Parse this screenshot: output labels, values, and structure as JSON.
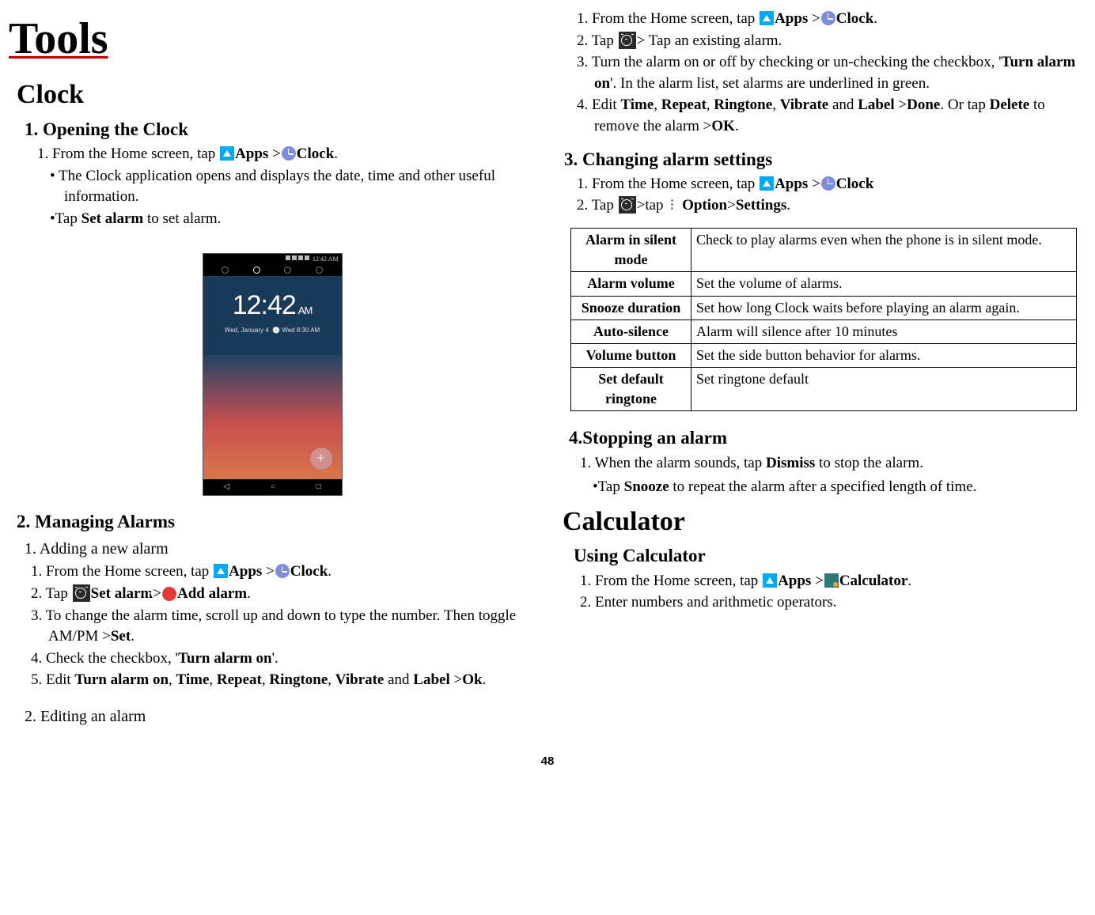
{
  "pageNumber": "48",
  "title": "Tools",
  "left": {
    "clockHeading": "Clock",
    "s1": {
      "heading": "1. Opening the Clock",
      "step1_pre": "1. From the Home screen, tap  ",
      "apps": "Apps",
      "gt": " >",
      "clock": "Clock",
      "period": ".",
      "b1": "• The Clock application opens and displays the date, time and other useful information.",
      "b2_pre": "•Tap ",
      "b2_bold": "Set alarm",
      "b2_post": " to set alarm."
    },
    "phone": {
      "statusTime": "12:42 AM",
      "time": "12:42",
      "ampm": "AM",
      "date": "Wed, January 4",
      "alarm": "Wed 8:30 AM",
      "plus": "+",
      "navBack": "◁",
      "navHome": "○",
      "navRecent": "□"
    },
    "s2": {
      "heading": "2. Managing Alarms",
      "sub1": "1. Adding a new alarm",
      "a1_pre": "1. From the Home screen, tap  ",
      "a1_apps": "Apps",
      "a1_gt": " >",
      "a1_clock": "Clock",
      "a1_period": ".",
      "a2_pre": "2. Tap  ",
      "a2_set": "Set alarm",
      "a2_gt": ">",
      "a2_add": "Add alarm",
      "a2_period": ".",
      "a3_pre": "3. To change the alarm time, scroll up and down to type the number. Then toggle AM/PM >",
      "a3_set": "Set",
      "a3_period": ".",
      "a4_pre": "4. Check the checkbox, '",
      "a4_bold": "Turn alarm on",
      "a4_post": "'.",
      "a5_pre": "5. Edit ",
      "a5_1": "Turn alarm on",
      "a5_c": ", ",
      "a5_2": "Time",
      "a5_3": "Repeat",
      "a5_4": "Ringtone",
      "a5_5": "Vibrate",
      "a5_and": " and ",
      "a5_6": "Label",
      "a5_gt": " >",
      "a5_7": "Ok",
      "a5_period": ".",
      "sub2": "2. Editing an alarm"
    }
  },
  "right": {
    "e1_pre": "1. From the Home screen, tap  ",
    "e1_apps": "Apps",
    "e1_gt": " >",
    "e1_clock": "Clock",
    "e1_period": ".",
    "e2_pre": "2. Tap  ",
    "e2_post": "> Tap an existing alarm.",
    "e3_pre": "3. Turn the alarm on or off by checking or un-checking the checkbox, '",
    "e3_bold": "Turn alarm on",
    "e3_post": "'. In the alarm list, set alarms are underlined in green.",
    "e4_pre": "4. Edit ",
    "e4_1": "Time",
    "e4_c": ", ",
    "e4_2": "Repeat",
    "e4_3": "Ringtone",
    "e4_4": "Vibrate",
    "e4_and": " and ",
    "e4_5": "Label",
    "e4_gt": " >",
    "e4_6": "Done",
    "e4_mid": ". Or tap ",
    "e4_7": "Delete",
    "e4_mid2": " to remove the alarm >",
    "e4_8": "OK",
    "e4_period": ".",
    "s3": {
      "heading": "3. Changing alarm settings",
      "c1_pre": "1. From the Home screen, tap  ",
      "c1_apps": "Apps",
      "c1_gt": " >",
      "c1_clock": "Clock",
      "c2_pre": "2. Tap  ",
      "c2_mid": ">tap ",
      "c2_opt": " Option",
      "c2_gt": ">",
      "c2_set": "Settings",
      "c2_period": "."
    },
    "table": [
      {
        "label": "Alarm in silent mode",
        "desc": "Check to play alarms even when the phone is in silent mode."
      },
      {
        "label": "Alarm volume",
        "desc": "Set the volume of alarms."
      },
      {
        "label": "Snooze duration",
        "desc": "Set how long Clock waits before playing an alarm again."
      },
      {
        "label": "Auto-silence",
        "desc": "Alarm will silence after 10 minutes"
      },
      {
        "label": "Volume button",
        "desc": "Set the side button behavior for alarms."
      },
      {
        "label": "Set default ringtone",
        "desc": "Set ringtone default"
      }
    ],
    "s4": {
      "heading": "4.Stopping an alarm",
      "line1_pre": "1. When the alarm sounds, tap ",
      "line1_bold": "Dismiss",
      "line1_post": " to stop the alarm.",
      "b1_pre": "•Tap ",
      "b1_bold": "Snooze",
      "b1_post": " to repeat the alarm after a specified length of time."
    },
    "calc": {
      "heading": "Calculator",
      "sub": "Using Calculator",
      "c1_pre": "1. From the Home screen, tap  ",
      "c1_apps": "Apps",
      "c1_gt": " >",
      "c1_calc": "Calculator",
      "c1_period": ".",
      "c2": "2. Enter numbers and arithmetic operators."
    }
  }
}
